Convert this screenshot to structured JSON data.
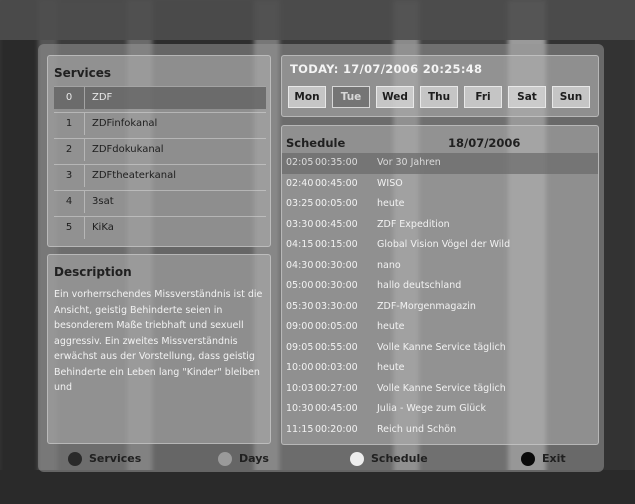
{
  "services": {
    "title": "Services",
    "items": [
      {
        "num": "0",
        "name": "ZDF"
      },
      {
        "num": "1",
        "name": "ZDFinfokanal"
      },
      {
        "num": "2",
        "name": "ZDFdokukanal"
      },
      {
        "num": "3",
        "name": "ZDFtheaterkanal"
      },
      {
        "num": "4",
        "name": "3sat"
      },
      {
        "num": "5",
        "name": "KiKa"
      }
    ],
    "selected_index": 0
  },
  "description": {
    "title": "Description",
    "text": "Ein vorherrschendes Missverständnis ist die Ansicht, geistig Behinderte seien in besonderem Maße triebhaft und sexuell aggressiv. Ein zweites Missverständnis erwächst aus der Vorstellung, dass geistig Behinderte ein Leben lang \"Kinder\" bleiben und"
  },
  "today": {
    "label": "TODAY: 17/07/2006 20:25:48",
    "days": [
      "Mon",
      "Tue",
      "Wed",
      "Thu",
      "Fri",
      "Sat",
      "Sun"
    ],
    "selected_day": "Tue"
  },
  "schedule": {
    "title": "Schedule",
    "date": "18/07/2006",
    "rows": [
      {
        "start": "02:05",
        "duration": "00:35:00",
        "title": "Vor 30 Jahren"
      },
      {
        "start": "02:40",
        "duration": "00:45:00",
        "title": "WISO"
      },
      {
        "start": "03:25",
        "duration": "00:05:00",
        "title": "heute"
      },
      {
        "start": "03:30",
        "duration": "00:45:00",
        "title": "ZDF Expedition"
      },
      {
        "start": "04:15",
        "duration": "00:15:00",
        "title": "Global Vision Vögel der Wild"
      },
      {
        "start": "04:30",
        "duration": "00:30:00",
        "title": "nano"
      },
      {
        "start": "05:00",
        "duration": "00:30:00",
        "title": "hallo deutschland"
      },
      {
        "start": "05:30",
        "duration": "03:30:00",
        "title": "ZDF-Morgenmagazin"
      },
      {
        "start": "09:00",
        "duration": "00:05:00",
        "title": "heute"
      },
      {
        "start": "09:05",
        "duration": "00:55:00",
        "title": "Volle Kanne Service täglich"
      },
      {
        "start": "10:00",
        "duration": "00:03:00",
        "title": "heute"
      },
      {
        "start": "10:03",
        "duration": "00:27:00",
        "title": "Volle Kanne Service täglich"
      },
      {
        "start": "10:30",
        "duration": "00:45:00",
        "title": "Julia - Wege zum Glück"
      },
      {
        "start": "11:15",
        "duration": "00:20:00",
        "title": "Reich und Schön"
      }
    ],
    "selected_index": 0
  },
  "footer": {
    "services_label": "Services",
    "days_label": "Days",
    "schedule_label": "Schedule",
    "exit_label": "Exit",
    "colors": {
      "services": "#2a2a2a",
      "days": "#9a9a9a",
      "schedule": "#ededed",
      "exit": "#0a0a0a"
    }
  }
}
